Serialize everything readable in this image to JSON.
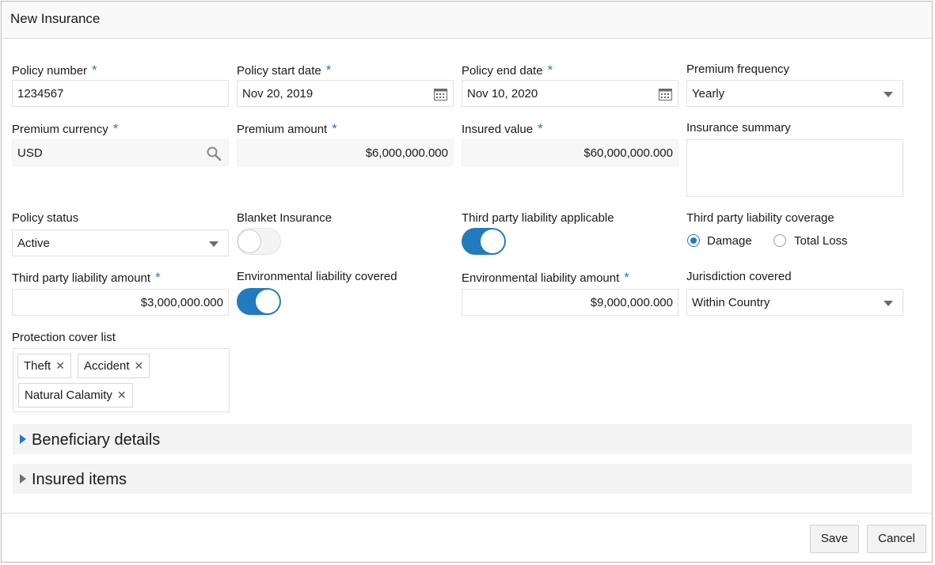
{
  "dialog": {
    "title": "New Insurance"
  },
  "fields": {
    "policy_number": {
      "label": "Policy number",
      "required": "*",
      "value": "1234567"
    },
    "policy_start_date": {
      "label": "Policy start date",
      "required": "*",
      "value": "Nov 20, 2019",
      "icon": "calendar-icon"
    },
    "policy_end_date": {
      "label": "Policy end date",
      "required": "*",
      "value": "Nov 10, 2020",
      "icon": "calendar-icon"
    },
    "premium_frequency": {
      "label": "Premium frequency",
      "value": "Yearly"
    },
    "premium_currency": {
      "label": "Premium currency",
      "required": "*",
      "value": "USD",
      "icon": "search-icon"
    },
    "premium_amount": {
      "label": "Premium amount",
      "required": "*",
      "value": "$6,000,000.000"
    },
    "insured_value": {
      "label": "Insured value",
      "required": "*",
      "value": "$60,000,000.000"
    },
    "insurance_summary": {
      "label": "Insurance summary",
      "value": ""
    },
    "policy_status": {
      "label": "Policy status",
      "value": "Active"
    },
    "blanket_insurance": {
      "label": "Blanket Insurance",
      "state": "off"
    },
    "third_party_applicable": {
      "label": "Third party liability applicable",
      "state": "on"
    },
    "third_party_coverage": {
      "label": "Third party liability coverage",
      "options": [
        "Damage",
        "Total Loss"
      ],
      "selected": "Damage"
    },
    "third_party_amount": {
      "label": "Third party liability amount",
      "required": "*",
      "value": "$3,000,000.000"
    },
    "environmental_covered": {
      "label": "Environmental liability covered",
      "state": "on"
    },
    "environmental_amount": {
      "label": "Environmental liability amount",
      "required": "*",
      "value": "$9,000,000.000"
    },
    "jurisdiction": {
      "label": "Jurisdiction covered",
      "value": "Within Country"
    },
    "protection_cover": {
      "label": "Protection cover list",
      "chips": [
        "Theft",
        "Accident",
        "Natural Calamity"
      ],
      "remove_glyph": "✕"
    }
  },
  "sections": [
    {
      "title": "Beneficiary details"
    },
    {
      "title": "Insured items"
    }
  ],
  "buttons": {
    "save": "Save",
    "cancel": "Cancel"
  },
  "colors": {
    "accent": "#227bbe",
    "required_marker": "#227bbe"
  }
}
